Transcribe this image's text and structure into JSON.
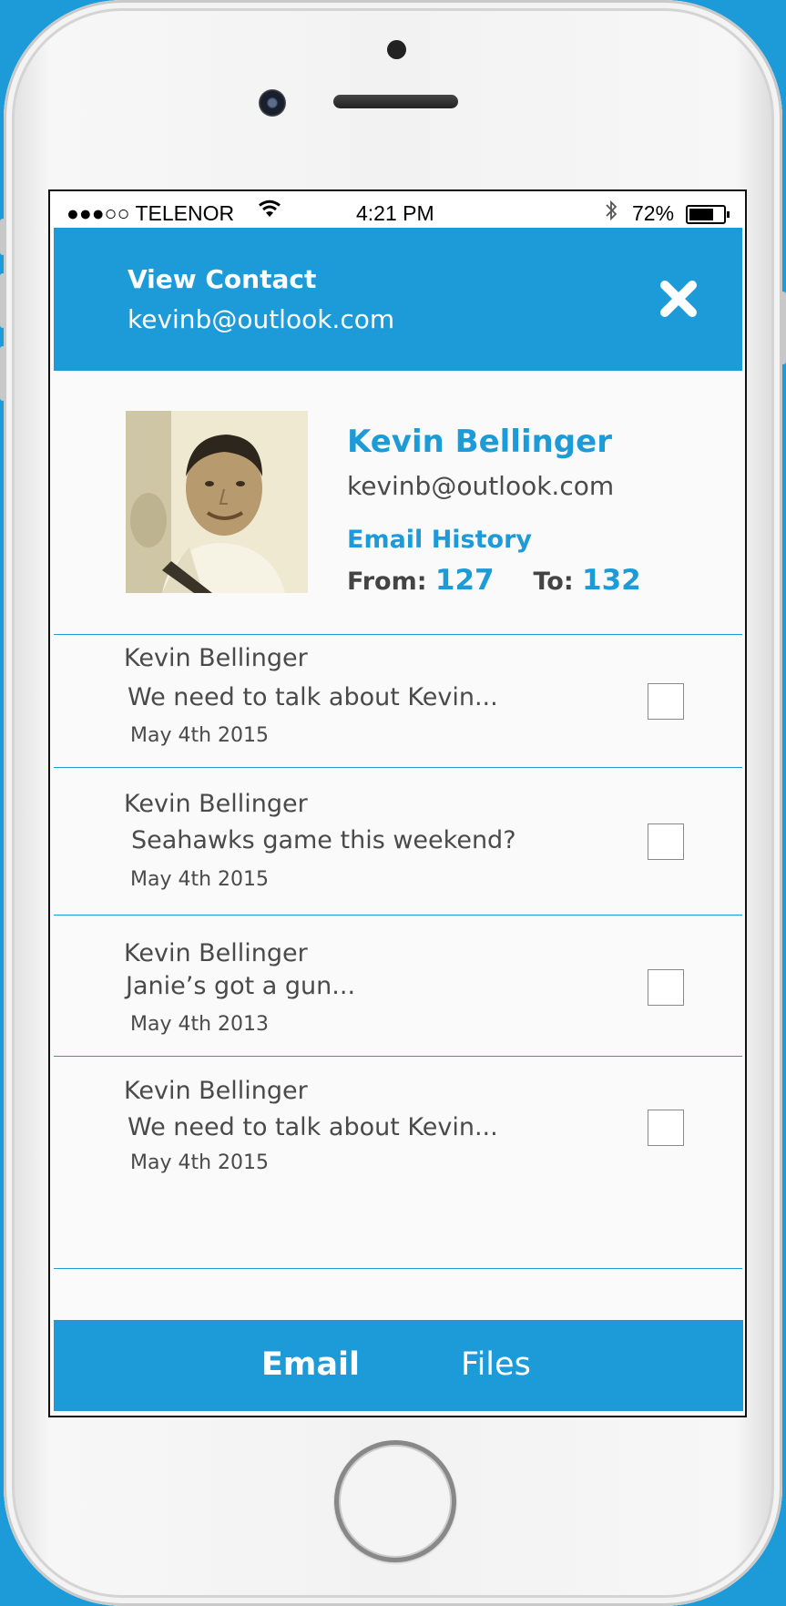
{
  "status_bar": {
    "signal": "●●●○○",
    "carrier": "TELENOR",
    "wifi_icon": "wifi-icon",
    "time": "4:21 PM",
    "bluetooth_icon": "bluetooth-icon",
    "battery_percent": "72%",
    "battery_level": 0.72
  },
  "header": {
    "title": "View Contact",
    "subtitle": "kevinb@outlook.com",
    "close_icon": "close-icon"
  },
  "profile": {
    "name": "Kevin Bellinger",
    "email": "kevinb@outlook.com",
    "history_label": "Email History",
    "from_label": "From:",
    "from_count": "127",
    "to_label": "To:",
    "to_count": "132"
  },
  "emails": [
    {
      "sender": "Kevin Bellinger",
      "subject": "We need to talk about Kevin...",
      "date": "May 4th 2015",
      "checked": false
    },
    {
      "sender": "Kevin Bellinger",
      "subject": "Seahawks game this weekend?",
      "date": "May 4th 2015",
      "checked": false
    },
    {
      "sender": "Kevin Bellinger",
      "subject": "Janie’s got a gun...",
      "date": "May 4th 2013",
      "checked": false
    },
    {
      "sender": "Kevin Bellinger",
      "subject": "We need to talk about Kevin...",
      "date": "May 4th 2015",
      "checked": false
    }
  ],
  "tabs": {
    "email": "Email",
    "files": "Files",
    "active": "Email"
  },
  "colors": {
    "accent": "#1d9bd8",
    "text": "#4a4a4a",
    "background": "#fafafa"
  }
}
